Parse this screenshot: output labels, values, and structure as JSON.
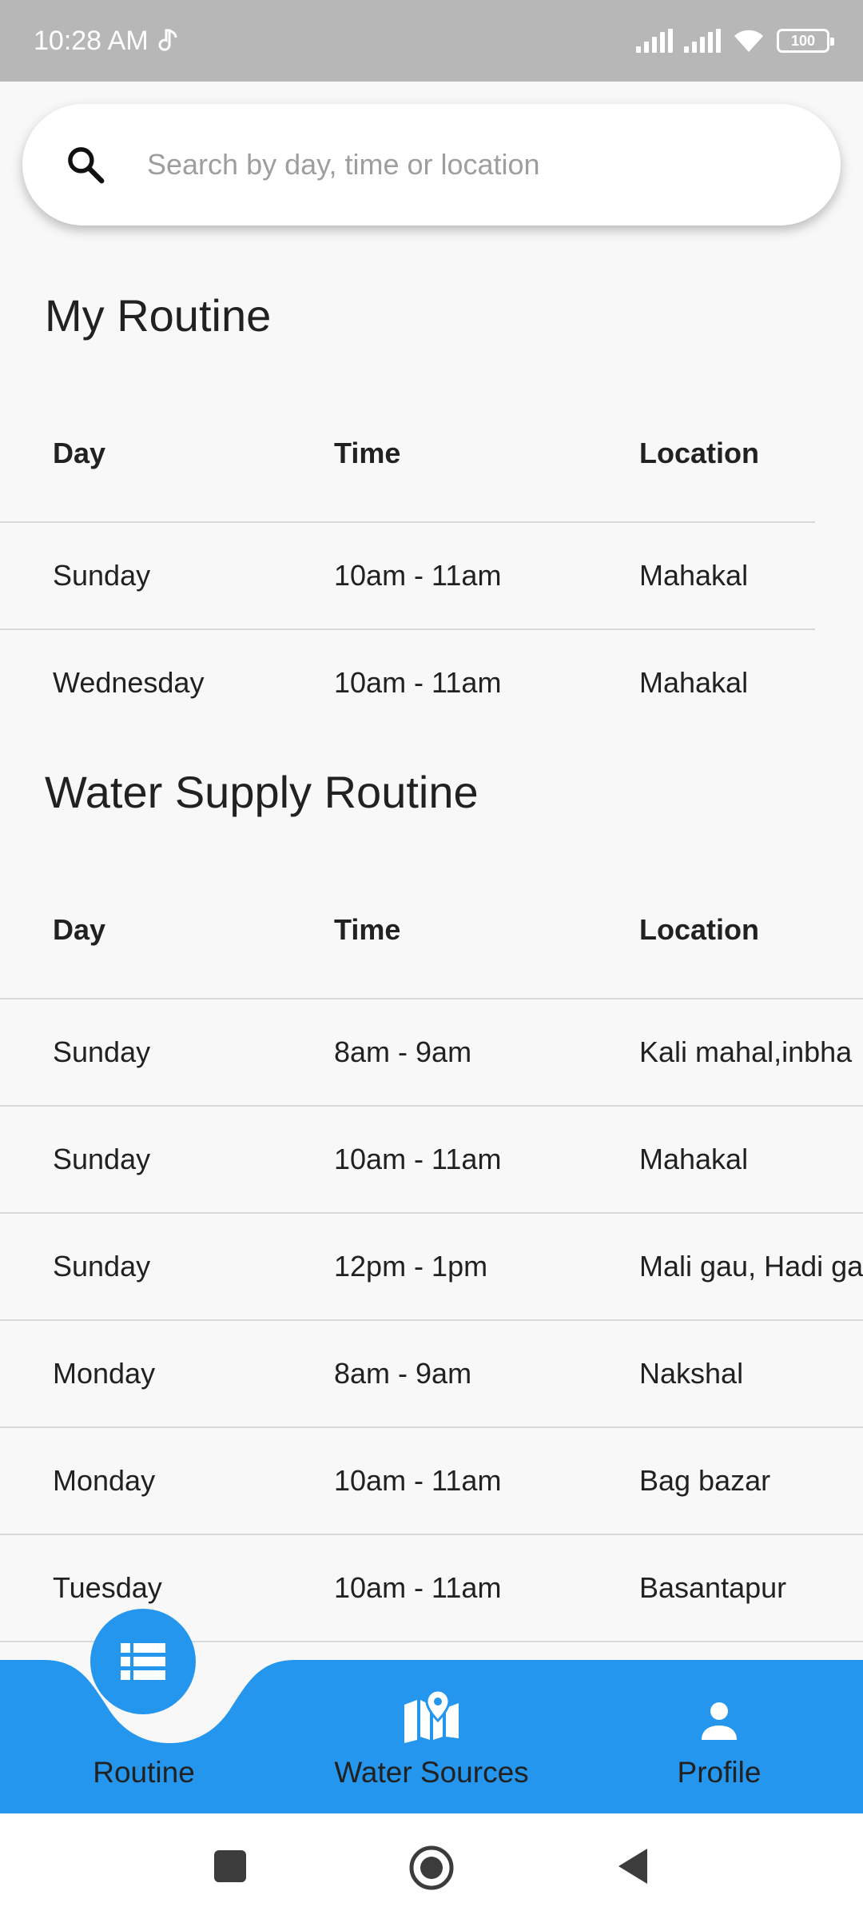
{
  "status_bar": {
    "time": "10:28 AM",
    "battery": "100"
  },
  "search": {
    "placeholder": "Search by day, time or location"
  },
  "my_routine": {
    "title": "My Routine",
    "headers": {
      "day": "Day",
      "time": "Time",
      "location": "Location"
    },
    "rows": [
      {
        "day": "Sunday",
        "time": "10am - 11am",
        "location": "Mahakal"
      },
      {
        "day": "Wednesday",
        "time": "10am - 11am",
        "location": "Mahakal"
      }
    ]
  },
  "water_supply_routine": {
    "title": "Water Supply Routine",
    "headers": {
      "day": "Day",
      "time": "Time",
      "location": "Location"
    },
    "rows": [
      {
        "day": "Sunday",
        "time": "8am - 9am",
        "location": "Kali mahal,inbha"
      },
      {
        "day": "Sunday",
        "time": "10am - 11am",
        "location": "Mahakal"
      },
      {
        "day": "Sunday",
        "time": "12pm - 1pm",
        "location": "Mali gau, Hadi ga"
      },
      {
        "day": "Monday",
        "time": "8am - 9am",
        "location": "Nakshal"
      },
      {
        "day": "Monday",
        "time": "10am - 11am",
        "location": "Bag bazar"
      },
      {
        "day": "Tuesday",
        "time": "10am - 11am",
        "location": "Basantapur"
      }
    ]
  },
  "bottom_nav": {
    "items": [
      {
        "label": "Routine",
        "icon": "list-icon",
        "active": true
      },
      {
        "label": "Water Sources",
        "icon": "map-pin-icon",
        "active": false
      },
      {
        "label": "Profile",
        "icon": "person-icon",
        "active": false
      }
    ]
  },
  "colors": {
    "accent": "#2496ed",
    "status_bar": "#b7b7b7",
    "background": "#f8f8f8"
  }
}
